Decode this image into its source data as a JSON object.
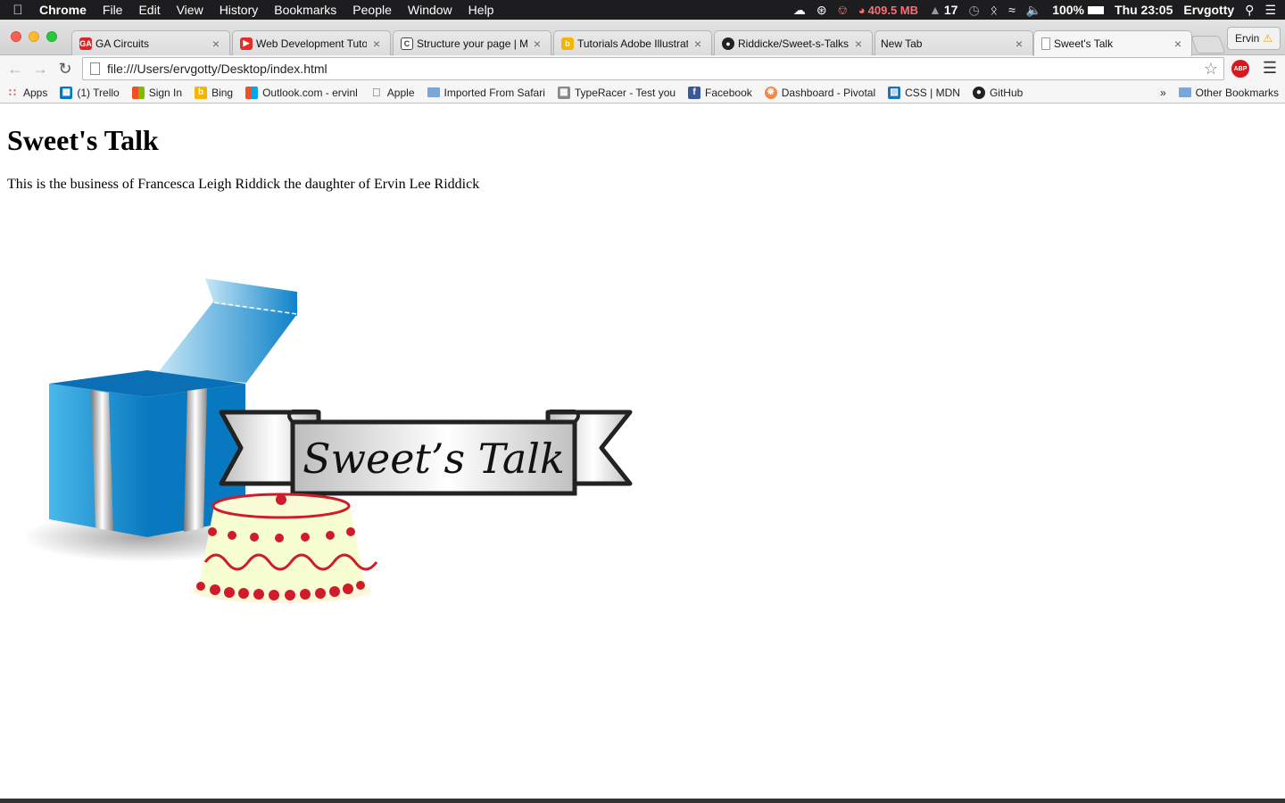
{
  "menubar": {
    "app": "Chrome",
    "items": [
      "File",
      "Edit",
      "View",
      "History",
      "Bookmarks",
      "People",
      "Window",
      "Help"
    ],
    "memory": "409.5 MB",
    "count": "17",
    "battery": "100%",
    "clock": "Thu 23:05",
    "user": "Ervgotty"
  },
  "tabs": [
    {
      "title": "GA Circuits",
      "favicon": "ga-icon",
      "color": "#d7262e"
    },
    {
      "title": "Web Development Tutor",
      "favicon": "youtube-icon",
      "color": "#e52d27"
    },
    {
      "title": "Structure your page | M",
      "favicon": "codecademy-icon",
      "color": "#444444"
    },
    {
      "title": "Tutorials Adobe Illustrat",
      "favicon": "bing-icon",
      "color": "#f4b400"
    },
    {
      "title": "Riddicke/Sweet-s-Talks",
      "favicon": "github-icon",
      "color": "#222222"
    },
    {
      "title": "New Tab",
      "favicon": "",
      "color": ""
    },
    {
      "title": "Sweet's Talk",
      "favicon": "page-icon",
      "color": "#ffffff"
    }
  ],
  "profile": "Ervin",
  "omnibox": {
    "url": "file:///Users/ervgotty/Desktop/index.html"
  },
  "bookmarks": [
    {
      "label": "Apps",
      "icon": "apps-grid-icon"
    },
    {
      "label": "(1) Trello",
      "icon": "trello-icon"
    },
    {
      "label": "Sign In",
      "icon": "microsoft-icon"
    },
    {
      "label": "Bing",
      "icon": "bing-icon"
    },
    {
      "label": "Outlook.com - ervinl",
      "icon": "microsoft-icon"
    },
    {
      "label": "Apple",
      "icon": "apple-icon"
    },
    {
      "label": "Imported From Safari",
      "icon": "folder-icon"
    },
    {
      "label": "TypeRacer - Test you",
      "icon": "typeracer-icon"
    },
    {
      "label": "Facebook",
      "icon": "facebook-icon"
    },
    {
      "label": "Dashboard - Pivotal",
      "icon": "pivotal-icon"
    },
    {
      "label": "CSS | MDN",
      "icon": "mdn-icon"
    },
    {
      "label": "GitHub",
      "icon": "github-icon"
    }
  ],
  "bookmarks_overflow": "»",
  "other_bookmarks": "Other Bookmarks",
  "page": {
    "heading": "Sweet's Talk",
    "paragraph": "This is the business of Francesca Leigh Riddick the daughter of Ervin Lee Riddick",
    "logo_text": "Sweet’s Talk"
  }
}
